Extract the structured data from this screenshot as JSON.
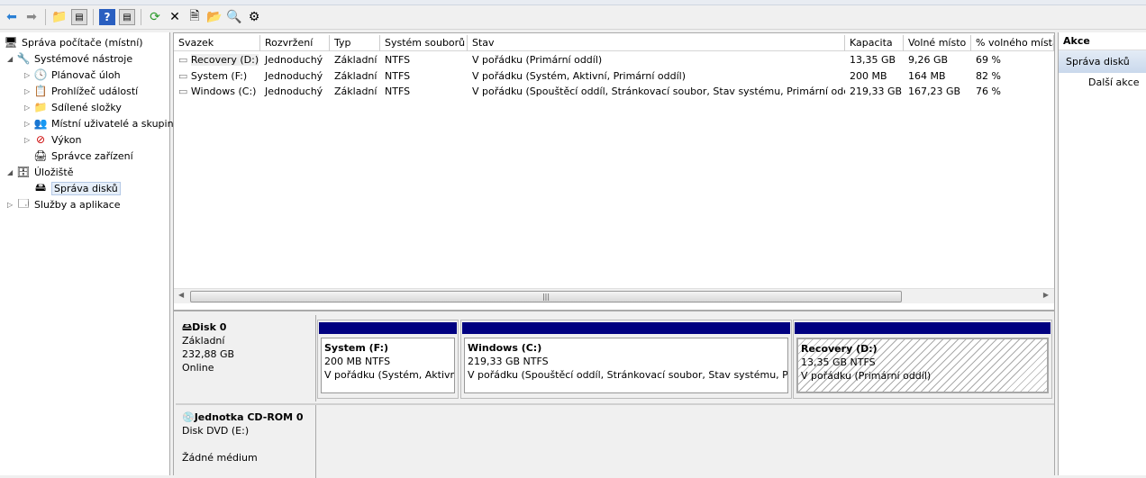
{
  "toolbar": {
    "buttons": [
      "back-icon",
      "forward-icon",
      "up-folder-icon",
      "show-hide-tree-icon",
      "help-icon",
      "show-hide-action-icon",
      "refresh-icon",
      "delete-icon",
      "properties-icon",
      "open-icon",
      "search-icon",
      "settings-icon"
    ]
  },
  "tree": {
    "root": "Správa počítače (místní)",
    "items": [
      "Systémové nástroje",
      "Plánovač úloh",
      "Prohlížeč událostí",
      "Sdílené složky",
      "Místní uživatelé a skupiny",
      "Výkon",
      "Správce zařízení",
      "Úložiště",
      "Správa disků",
      "Služby a aplikace"
    ]
  },
  "table": {
    "headers": [
      "Svazek",
      "Rozvržení",
      "Typ",
      "Systém souborů",
      "Stav",
      "Kapacita",
      "Volné místo",
      "% volného místa"
    ],
    "rows": [
      [
        "Recovery (D:)",
        "Jednoduchý",
        "Základní",
        "NTFS",
        "V pořádku (Primární oddíl)",
        "13,35 GB",
        "9,26 GB",
        "69 %"
      ],
      [
        "System (F:)",
        "Jednoduchý",
        "Základní",
        "NTFS",
        "V pořádku (Systém, Aktivní, Primární oddíl)",
        "200 MB",
        "164 MB",
        "82 %"
      ],
      [
        "Windows (C:)",
        "Jednoduchý",
        "Základní",
        "NTFS",
        "V pořádku (Spouštěcí oddíl, Stránkovací soubor, Stav systému, Primární oddíl)",
        "219,33 GB",
        "167,23 GB",
        "76 %"
      ]
    ]
  },
  "disks": [
    {
      "name": "Disk 0",
      "type": "Základní",
      "size": "232,88 GB",
      "status": "Online",
      "partitions": [
        {
          "name": "System  (F:)",
          "size": "200 MB NTFS",
          "status": "V pořádku (Systém, Aktivní, Primární oddíl)"
        },
        {
          "name": "Windows  (C:)",
          "size": "219,33 GB NTFS",
          "status": "V pořádku (Spouštěcí oddíl, Stránkovací soubor, Stav systému, Primární oddíl)"
        },
        {
          "name": "Recovery  (D:)",
          "size": "13,35 GB NTFS",
          "status": "V pořádku (Primární oddíl)"
        }
      ]
    },
    {
      "name": "Jednotka CD-ROM 0",
      "type": "Disk DVD (E:)",
      "status": "Žádné médium"
    }
  ],
  "actions": {
    "title": "Akce",
    "section": "Správa disků",
    "more": "Další akce"
  },
  "colors": {
    "partition_bar": "#000080",
    "selection": "#dce7f5"
  }
}
